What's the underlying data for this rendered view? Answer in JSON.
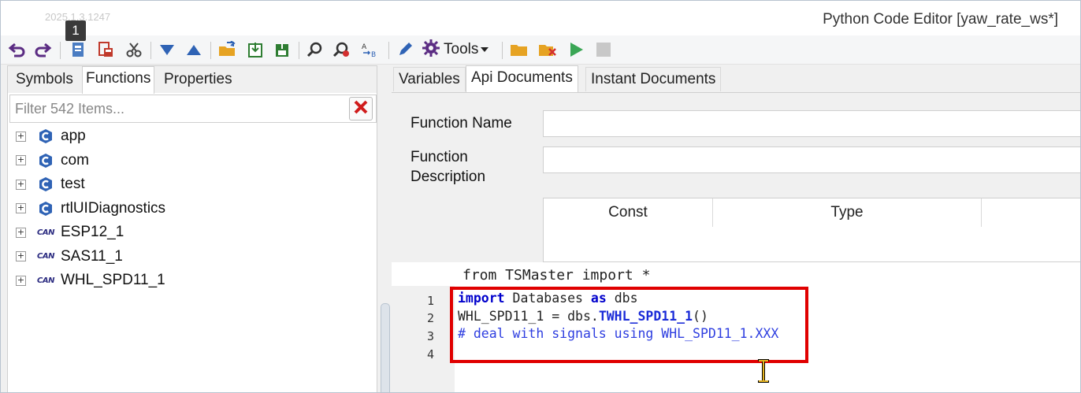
{
  "window": {
    "title": "Python Code Editor [yaw_rate_ws*]",
    "version": "2025.1.3.1247",
    "badge": "1"
  },
  "toolbar": {
    "tools_label": "Tools",
    "icons": [
      "undo-icon",
      "redo-icon",
      "save-icon",
      "save-as-icon",
      "cut-icon",
      "move-down-icon",
      "move-up-icon",
      "open-folder-icon",
      "export-icon",
      "import-icon",
      "find-icon",
      "find-replace-icon",
      "spell-check-icon",
      "edit-icon",
      "gear-icon",
      "folder-icon",
      "clear-icon",
      "run-icon",
      "stop-icon"
    ]
  },
  "left_panel": {
    "tabs": [
      "Symbols",
      "Functions",
      "Properties"
    ],
    "active_tab": "Functions",
    "filter_placeholder": "Filter 542 Items...",
    "tree": [
      {
        "label": "app",
        "icon": "python-module-icon"
      },
      {
        "label": "com",
        "icon": "python-module-icon"
      },
      {
        "label": "test",
        "icon": "python-module-icon"
      },
      {
        "label": "rtlUIDiagnostics",
        "icon": "python-module-icon"
      },
      {
        "label": "ESP12_1",
        "icon": "can-icon"
      },
      {
        "label": "SAS11_1",
        "icon": "can-icon"
      },
      {
        "label": "WHL_SPD11_1",
        "icon": "can-icon"
      }
    ],
    "can_tag": "CAN"
  },
  "right_panel": {
    "tabs": [
      "Variables",
      "Api Documents",
      "Instant Documents"
    ],
    "active_tab": "Api Documents",
    "function_name_label": "Function Name",
    "function_desc_label_1": "Function",
    "function_desc_label_2": "Description",
    "grid_headers": [
      "Const",
      "Type"
    ]
  },
  "editor": {
    "header_line": "from TSMaster import *",
    "line_numbers": [
      "1",
      "2",
      "3",
      "4"
    ],
    "lines": {
      "l1_kw1": "import",
      "l1_mid": " Databases ",
      "l1_kw2": "as",
      "l1_end": " dbs",
      "l2_start": "WHL_SPD11_1 = dbs.",
      "l2_fn": "TWHL_SPD11_1",
      "l2_end": "()",
      "l3_comment": "# deal with signals using WHL_SPD11_1.XXX"
    }
  },
  "colors": {
    "highlight_box": "#e00000",
    "keyword": "#0000cc",
    "comment": "#2e3ee0"
  }
}
